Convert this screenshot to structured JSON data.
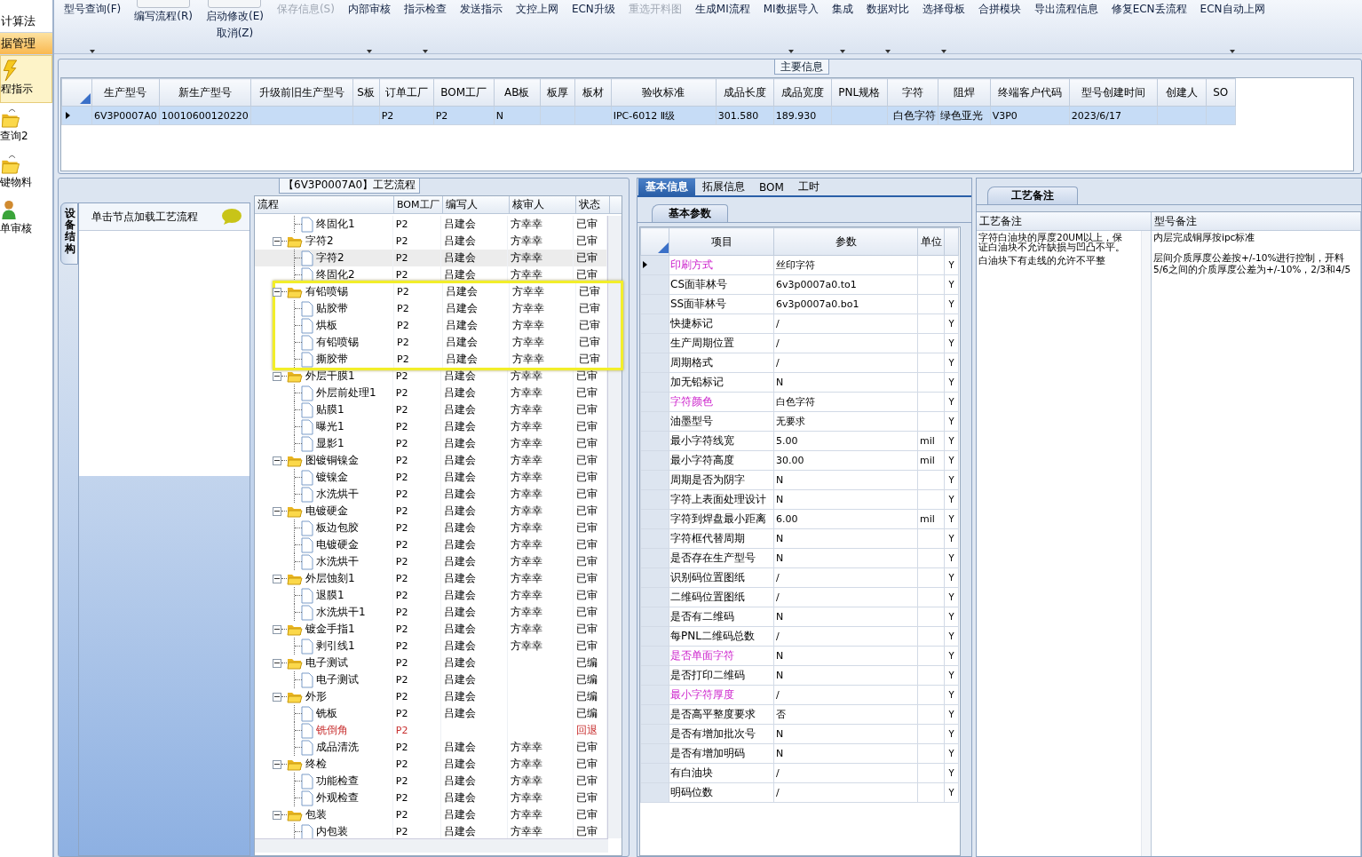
{
  "sidebar": {
    "sections": [
      {
        "label": "计算法",
        "selected": false
      },
      {
        "label": "据管理",
        "selected": true
      }
    ],
    "items": [
      {
        "label": "程指示",
        "kind": "bolt",
        "selected": true
      },
      {
        "label": "查询2",
        "kind": "folder",
        "selected": false
      },
      {
        "label": "键物料",
        "kind": "folder",
        "selected": false
      },
      {
        "label": "单审核",
        "kind": "person",
        "selected": false
      }
    ]
  },
  "toolbar": [
    {
      "kind": "plain",
      "label": "型号查询(F)",
      "caret": true,
      "disabled": false
    },
    {
      "kind": "toggle",
      "label": "编写流程(R)",
      "on": false,
      "caret": false,
      "disabled": false
    },
    {
      "kind": "toggle",
      "label": "启动修改(E)",
      "second_line": "取消(Z)",
      "on": false,
      "caret": false,
      "disabled": false
    },
    {
      "kind": "plain",
      "label": "保存信息(S)",
      "caret": false,
      "disabled": true
    },
    {
      "kind": "plain",
      "label": "内部审核",
      "caret": true,
      "disabled": false
    },
    {
      "kind": "plain",
      "label": "指示检查",
      "caret": true,
      "disabled": false
    },
    {
      "kind": "plain",
      "label": "发送指示",
      "caret": false,
      "disabled": false
    },
    {
      "kind": "plain",
      "label": "文控上网",
      "caret": false,
      "disabled": false
    },
    {
      "kind": "plain",
      "label": "ECN升级",
      "caret": false,
      "disabled": false
    },
    {
      "kind": "plain",
      "label": "重选开料图",
      "caret": false,
      "disabled": true
    },
    {
      "kind": "plain",
      "label": "生成MI流程",
      "caret": false,
      "disabled": false
    },
    {
      "kind": "plain",
      "label": "MI数据导入",
      "caret": true,
      "disabled": false
    },
    {
      "kind": "plain",
      "label": "集成",
      "caret": true,
      "disabled": false
    },
    {
      "kind": "plain",
      "label": "数据对比",
      "caret": true,
      "disabled": false
    },
    {
      "kind": "plain",
      "label": "选择母板",
      "caret": true,
      "disabled": false
    },
    {
      "kind": "plain",
      "label": "合拼模块",
      "caret": false,
      "disabled": false
    },
    {
      "kind": "plain",
      "label": "导出流程信息",
      "caret": false,
      "disabled": false
    },
    {
      "kind": "plain",
      "label": "修复ECN丢流程",
      "caret": false,
      "disabled": false
    },
    {
      "kind": "plain",
      "label": "ECN自动上网",
      "caret": true,
      "disabled": false
    }
  ],
  "main_info": {
    "title": "主要信息",
    "columns": [
      "生产型号",
      "新生产型号",
      "升级前旧生产型号",
      "S板",
      "订单工厂",
      "BOM工厂",
      "AB板",
      "板厚",
      "板材",
      "验收标准",
      "成品长度",
      "成品宽度",
      "PNL规格",
      "字符",
      "阻焊",
      "终端客户代码",
      "型号创建时间",
      "创建人",
      "SO"
    ],
    "rows": [
      {
        "selected": true,
        "cells": [
          "6V3P0007A0",
          "10010600120220",
          null,
          null,
          "P2",
          "P2",
          "N",
          null,
          null,
          "IPC-6012 Ⅱ级",
          "301.580",
          "189.930",
          null,
          "白色字符",
          "绿色亚光",
          "V3P0",
          "2023/6/17",
          null,
          null
        ]
      }
    ]
  },
  "flow_panel": {
    "title": "【6V3P0007A0】工艺流程",
    "side_tab": "设备结构",
    "hint": "单击节点加载工艺流程",
    "columns": [
      "流程",
      "BOM工厂",
      "编写人",
      "核审人",
      "状态"
    ],
    "rows": [
      {
        "children": [
          {
            "name": "终固化1",
            "factory": "P2",
            "writer": "吕建会",
            "reviewer": "方幸幸",
            "status": "已审",
            "rejected": false,
            "selected": false
          }
        ]
      },
      {
        "name": "字符2",
        "factory": "P2",
        "writer": "吕建会",
        "reviewer": "方幸幸",
        "status": "已审",
        "rejected": false,
        "selected": false,
        "expanded": true,
        "highlighted": false,
        "children": [
          {
            "name": "字符2",
            "factory": "P2",
            "writer": "吕建会",
            "reviewer": "方幸幸",
            "status": "已审",
            "rejected": false,
            "selected": true
          },
          {
            "name": "终固化2",
            "factory": "P2",
            "writer": "吕建会",
            "reviewer": "方幸幸",
            "status": "已审",
            "rejected": false,
            "selected": false
          }
        ]
      },
      {
        "name": "有铅喷锡",
        "factory": "P2",
        "writer": "吕建会",
        "reviewer": "方幸幸",
        "status": "已审",
        "rejected": false,
        "selected": false,
        "expanded": true,
        "highlighted": true,
        "children": [
          {
            "name": "贴胶带",
            "factory": "P2",
            "writer": "吕建会",
            "reviewer": "方幸幸",
            "status": "已审",
            "rejected": false,
            "selected": false
          },
          {
            "name": "烘板",
            "factory": "P2",
            "writer": "吕建会",
            "reviewer": "方幸幸",
            "status": "已审",
            "rejected": false,
            "selected": false
          },
          {
            "name": "有铅喷锡",
            "factory": "P2",
            "writer": "吕建会",
            "reviewer": "方幸幸",
            "status": "已审",
            "rejected": false,
            "selected": false
          },
          {
            "name": "撕胶带",
            "factory": "P2",
            "writer": "吕建会",
            "reviewer": "方幸幸",
            "status": "已审",
            "rejected": false,
            "selected": false
          }
        ]
      },
      {
        "name": "外层干膜1",
        "factory": "P2",
        "writer": "吕建会",
        "reviewer": "方幸幸",
        "status": "已审",
        "rejected": false,
        "selected": false,
        "expanded": true,
        "highlighted": false,
        "children": [
          {
            "name": "外层前处理1",
            "factory": "P2",
            "writer": "吕建会",
            "reviewer": "方幸幸",
            "status": "已审",
            "rejected": false,
            "selected": false
          },
          {
            "name": "贴膜1",
            "factory": "P2",
            "writer": "吕建会",
            "reviewer": "方幸幸",
            "status": "已审",
            "rejected": false,
            "selected": false
          },
          {
            "name": "曝光1",
            "factory": "P2",
            "writer": "吕建会",
            "reviewer": "方幸幸",
            "status": "已审",
            "rejected": false,
            "selected": false
          },
          {
            "name": "显影1",
            "factory": "P2",
            "writer": "吕建会",
            "reviewer": "方幸幸",
            "status": "已审",
            "rejected": false,
            "selected": false
          }
        ]
      },
      {
        "name": "图镀铜镍金",
        "factory": "P2",
        "writer": "吕建会",
        "reviewer": "方幸幸",
        "status": "已审",
        "rejected": false,
        "selected": false,
        "expanded": true,
        "highlighted": false,
        "children": [
          {
            "name": "镀镍金",
            "factory": "P2",
            "writer": "吕建会",
            "reviewer": "方幸幸",
            "status": "已审",
            "rejected": false,
            "selected": false
          },
          {
            "name": "水洗烘干",
            "factory": "P2",
            "writer": "吕建会",
            "reviewer": "方幸幸",
            "status": "已审",
            "rejected": false,
            "selected": false
          }
        ]
      },
      {
        "name": "电镀硬金",
        "factory": "P2",
        "writer": "吕建会",
        "reviewer": "方幸幸",
        "status": "已审",
        "rejected": false,
        "selected": false,
        "expanded": true,
        "highlighted": false,
        "children": [
          {
            "name": "板边包胶",
            "factory": "P2",
            "writer": "吕建会",
            "reviewer": "方幸幸",
            "status": "已审",
            "rejected": false,
            "selected": false
          },
          {
            "name": "电镀硬金",
            "factory": "P2",
            "writer": "吕建会",
            "reviewer": "方幸幸",
            "status": "已审",
            "rejected": false,
            "selected": false
          },
          {
            "name": "水洗烘干",
            "factory": "P2",
            "writer": "吕建会",
            "reviewer": "方幸幸",
            "status": "已审",
            "rejected": false,
            "selected": false
          }
        ]
      },
      {
        "name": "外层蚀刻1",
        "factory": "P2",
        "writer": "吕建会",
        "reviewer": "方幸幸",
        "status": "已审",
        "rejected": false,
        "selected": false,
        "expanded": true,
        "highlighted": false,
        "children": [
          {
            "name": "退膜1",
            "factory": "P2",
            "writer": "吕建会",
            "reviewer": "方幸幸",
            "status": "已审",
            "rejected": false,
            "selected": false
          },
          {
            "name": "水洗烘干1",
            "factory": "P2",
            "writer": "吕建会",
            "reviewer": "方幸幸",
            "status": "已审",
            "rejected": false,
            "selected": false
          }
        ]
      },
      {
        "name": "镀金手指1",
        "factory": "P2",
        "writer": "吕建会",
        "reviewer": "方幸幸",
        "status": "已审",
        "rejected": false,
        "selected": false,
        "expanded": true,
        "highlighted": false,
        "children": [
          {
            "name": "剥引线1",
            "factory": "P2",
            "writer": "吕建会",
            "reviewer": "方幸幸",
            "status": "已审",
            "rejected": false,
            "selected": false
          }
        ]
      },
      {
        "name": "电子测试",
        "factory": "P2",
        "writer": "吕建会",
        "status": "已编",
        "rejected": false,
        "selected": false,
        "expanded": true,
        "highlighted": false,
        "children": [
          {
            "name": "电子测试",
            "factory": "P2",
            "writer": "吕建会",
            "status": "已编",
            "rejected": false,
            "selected": false
          }
        ]
      },
      {
        "name": "外形",
        "factory": "P2",
        "writer": "吕建会",
        "status": "已编",
        "rejected": false,
        "selected": false,
        "expanded": true,
        "highlighted": false,
        "children": [
          {
            "name": "铣板",
            "factory": "P2",
            "writer": "吕建会",
            "status": "已编",
            "rejected": false,
            "selected": false
          },
          {
            "name": "铣倒角",
            "factory": "P2",
            "status": "回退",
            "rejected": true,
            "selected": false
          },
          {
            "name": "成品清洗",
            "factory": "P2",
            "writer": "吕建会",
            "reviewer": "方幸幸",
            "status": "已审",
            "rejected": false,
            "selected": false
          }
        ]
      },
      {
        "name": "终检",
        "factory": "P2",
        "writer": "吕建会",
        "reviewer": "方幸幸",
        "status": "已审",
        "rejected": false,
        "selected": false,
        "expanded": true,
        "highlighted": false,
        "children": [
          {
            "name": "功能检查",
            "factory": "P2",
            "writer": "吕建会",
            "reviewer": "方幸幸",
            "status": "已审",
            "rejected": false,
            "selected": false
          },
          {
            "name": "外观检查",
            "factory": "P2",
            "writer": "吕建会",
            "reviewer": "方幸幸",
            "status": "已审",
            "rejected": false,
            "selected": false
          }
        ]
      },
      {
        "name": "包装",
        "factory": "P2",
        "writer": "吕建会",
        "reviewer": "方幸幸",
        "status": "已审",
        "rejected": false,
        "selected": false,
        "expanded": true,
        "highlighted": false,
        "children": [
          {
            "name": "内包装",
            "factory": "P2",
            "writer": "吕建会",
            "reviewer": "方幸幸",
            "status": "已审",
            "rejected": false,
            "selected": false
          }
        ]
      }
    ]
  },
  "params": {
    "tabs": [
      {
        "label": "基本信息",
        "selected": true
      },
      {
        "label": "拓展信息",
        "selected": false
      },
      {
        "label": "BOM",
        "selected": false
      },
      {
        "label": "工时",
        "selected": false
      }
    ],
    "sub_tab": "基本参数",
    "columns": [
      "项目",
      "参数",
      "单位"
    ],
    "rows": [
      {
        "item": "印刷方式",
        "value": "丝印字符",
        "flag": "Y",
        "highlighted": true,
        "selected": true
      },
      {
        "item": "CS面菲林号",
        "value": "6v3p0007a0.to1",
        "flag": "Y",
        "highlighted": false,
        "selected": false
      },
      {
        "item": "SS面菲林号",
        "value": "6v3p0007a0.bo1",
        "flag": "Y",
        "highlighted": false,
        "selected": false
      },
      {
        "item": "快捷标记",
        "value": "/",
        "flag": "Y",
        "highlighted": false,
        "selected": false
      },
      {
        "item": "生产周期位置",
        "value": "/",
        "flag": "Y",
        "highlighted": false,
        "selected": false
      },
      {
        "item": "周期格式",
        "value": "/",
        "flag": "Y",
        "highlighted": false,
        "selected": false
      },
      {
        "item": "加无铅标记",
        "value": "N",
        "flag": "Y",
        "highlighted": false,
        "selected": false
      },
      {
        "item": "字符颜色",
        "value": "白色字符",
        "flag": "Y",
        "highlighted": true,
        "selected": false
      },
      {
        "item": "油墨型号",
        "value": "无要求",
        "flag": "Y",
        "highlighted": false,
        "selected": false
      },
      {
        "item": "最小字符线宽",
        "value": "5.00",
        "unit": "mil",
        "flag": "Y",
        "highlighted": false,
        "selected": false
      },
      {
        "item": "最小字符高度",
        "value": "30.00",
        "unit": "mil",
        "flag": "Y",
        "highlighted": false,
        "selected": false
      },
      {
        "item": "周期是否为阴字",
        "value": "N",
        "flag": "Y",
        "highlighted": false,
        "selected": false
      },
      {
        "item": "字符上表面处理设计",
        "value": "N",
        "flag": "Y",
        "highlighted": false,
        "selected": false
      },
      {
        "item": "字符到焊盘最小距离",
        "value": "6.00",
        "unit": "mil",
        "flag": "Y",
        "highlighted": false,
        "selected": false
      },
      {
        "item": "字符框代替周期",
        "value": "N",
        "flag": "Y",
        "highlighted": false,
        "selected": false
      },
      {
        "item": "是否存在生产型号",
        "value": "N",
        "flag": "Y",
        "highlighted": false,
        "selected": false
      },
      {
        "item": "识别码位置图纸",
        "value": "/",
        "flag": "Y",
        "highlighted": false,
        "selected": false
      },
      {
        "item": "二维码位置图纸",
        "value": "/",
        "flag": "Y",
        "highlighted": false,
        "selected": false
      },
      {
        "item": "是否有二维码",
        "value": "N",
        "flag": "Y",
        "highlighted": false,
        "selected": false
      },
      {
        "item": "每PNL二维码总数",
        "value": "/",
        "flag": "Y",
        "highlighted": false,
        "selected": false
      },
      {
        "item": "是否单面字符",
        "value": "N",
        "flag": "Y",
        "highlighted": true,
        "selected": false
      },
      {
        "item": "是否打印二维码",
        "value": "N",
        "flag": "Y",
        "highlighted": false,
        "selected": false
      },
      {
        "item": "最小字符厚度",
        "value": "/",
        "flag": "Y",
        "highlighted": true,
        "selected": false
      },
      {
        "item": "是否高平整度要求",
        "value": "否",
        "flag": "Y",
        "highlighted": false,
        "selected": false
      },
      {
        "item": "是否有增加批次号",
        "value": "N",
        "flag": "Y",
        "highlighted": false,
        "selected": false
      },
      {
        "item": "是否有增加明码",
        "value": "N",
        "flag": "Y",
        "highlighted": false,
        "selected": false
      },
      {
        "item": "有白油块",
        "value": "/",
        "flag": "Y",
        "highlighted": false,
        "selected": false
      },
      {
        "item": "明码位数",
        "value": "/",
        "flag": "Y",
        "highlighted": false,
        "selected": false
      }
    ]
  },
  "remarks": {
    "tab": "工艺备注",
    "columns": [
      "工艺备注",
      "型号备注"
    ],
    "process_notes": [
      "字符白油块的厚度20UM以上，保证白油块不允许缺损与凹凸不平。",
      "白油块下有走线的允许不平整"
    ],
    "model_notes": [
      "内层完成铜厚按ipc标准",
      "层间介质厚度公差按+/-10%进行控制，开料",
      "5/6之间的介质厚度公差为+/-10%，2/3和4/5"
    ]
  }
}
